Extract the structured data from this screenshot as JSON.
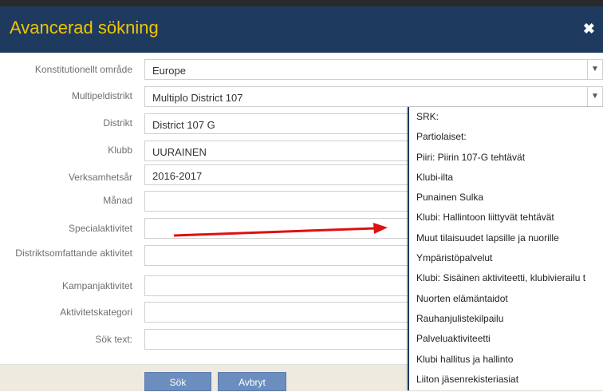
{
  "dialog": {
    "title": "Avancerad sökning",
    "close_glyph": "✖"
  },
  "form": {
    "rows": [
      {
        "label": "Konstitutionellt område",
        "value": "Europe",
        "type": "select"
      },
      {
        "label": "Multipeldistrikt",
        "value": "Multiplo District 107",
        "type": "select"
      },
      {
        "label": "Distrikt",
        "value": "District 107 G",
        "type": "text"
      },
      {
        "label": "Klubb",
        "value": "UURAINEN",
        "type": "text"
      },
      {
        "label": "Verksamhetsår",
        "value": "2016-2017",
        "type": "text"
      },
      {
        "label": "Månad",
        "value": "",
        "type": "text"
      },
      {
        "label": "Specialaktivitet",
        "value": "",
        "type": "text"
      },
      {
        "label": "Distriktsomfattande aktivitet",
        "value": "",
        "type": "text"
      },
      {
        "label": "Kampanjaktivitet",
        "value": "",
        "type": "text"
      },
      {
        "label": "Aktivitetskategori",
        "value": "",
        "type": "text"
      },
      {
        "label": "Sök text:",
        "value": "",
        "type": "text"
      }
    ]
  },
  "buttons": {
    "search": "Sök",
    "cancel": "Avbryt"
  },
  "dropdown": {
    "items": [
      "SRK:",
      "Partiolaiset:",
      "Piiri: Piirin 107-G tehtävät",
      "Klubi-ilta",
      "Punainen Sulka",
      "Klubi: Hallintoon liittyvät tehtävät",
      "Muut tilaisuudet lapsille ja nuorille",
      "Ympäristöpalvelut",
      "Klubi: Sisäinen aktiviteetti, klubivierailu t",
      "Nuorten elämäntaidot",
      "Rauhanjulistekilpailu",
      "Palveluaktiviteetti",
      "Klubi hallitus ja hallinto",
      "Liiton jäsenrekisteriasiat"
    ]
  },
  "colors": {
    "header_bg": "#1e3a5f",
    "title": "#f2c500",
    "button_bg": "#6c8ebf",
    "annotation_arrow": "#e01010"
  }
}
